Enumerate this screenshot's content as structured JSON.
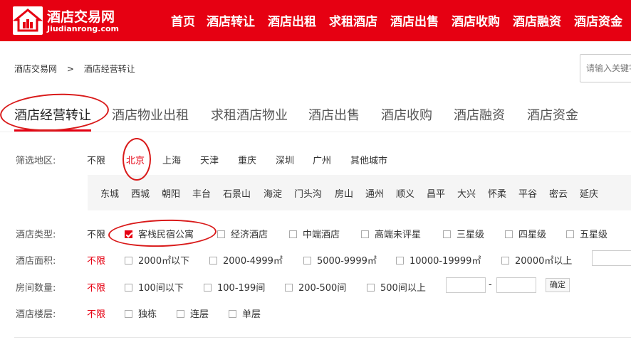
{
  "colors": {
    "brand_red": "#e60012",
    "annotation_red": "#d91a1a"
  },
  "header": {
    "logo_icon": "house-logo-icon",
    "logo_title": "酒店交易网",
    "logo_sub": "Jiudianrong.com",
    "nav": [
      "首页",
      "酒店转让",
      "酒店出租",
      "求租酒店",
      "酒店出售",
      "酒店收购",
      "酒店融资",
      "酒店资金"
    ]
  },
  "breadcrumb": {
    "home": "酒店交易网",
    "sep": ">",
    "current": "酒店经营转让"
  },
  "search": {
    "placeholder": "请输入关键字"
  },
  "tabs": [
    "酒店经营转让",
    "酒店物业出租",
    "求租酒店物业",
    "酒店出售",
    "酒店收购",
    "酒店融资",
    "酒店资金"
  ],
  "active_tab": "酒店经营转让",
  "filters": {
    "region": {
      "label": "筛选地区:",
      "options": [
        "不限",
        "北京",
        "上海",
        "天津",
        "重庆",
        "深圳",
        "广州",
        "其他城市"
      ],
      "selected": "北京",
      "districts": [
        "东城",
        "西城",
        "朝阳",
        "丰台",
        "石景山",
        "海淀",
        "门头沟",
        "房山",
        "通州",
        "顺义",
        "昌平",
        "大兴",
        "怀柔",
        "平谷",
        "密云",
        "延庆"
      ]
    },
    "type": {
      "label": "酒店类型:",
      "unlimited": "不限",
      "options": [
        "客栈民宿公寓",
        "经济酒店",
        "中端酒店",
        "高端未评星",
        "三星级",
        "四星级",
        "五星级"
      ],
      "checked": [
        "客栈民宿公寓"
      ]
    },
    "area": {
      "label": "酒店面积:",
      "unlimited": "不限",
      "options": [
        "2000㎡以下",
        "2000-4999㎡",
        "5000-9999㎡",
        "10000-19999㎡",
        "20000㎡以上"
      ]
    },
    "rooms": {
      "label": "房间数量:",
      "unlimited": "不限",
      "options": [
        "100间以下",
        "100-199间",
        "200-500间",
        "500间以上"
      ],
      "range_sep": "-",
      "confirm": "确定"
    },
    "floors": {
      "label": "酒店楼层:",
      "unlimited": "不限",
      "options": [
        "独栋",
        "连层",
        "单层"
      ]
    }
  }
}
